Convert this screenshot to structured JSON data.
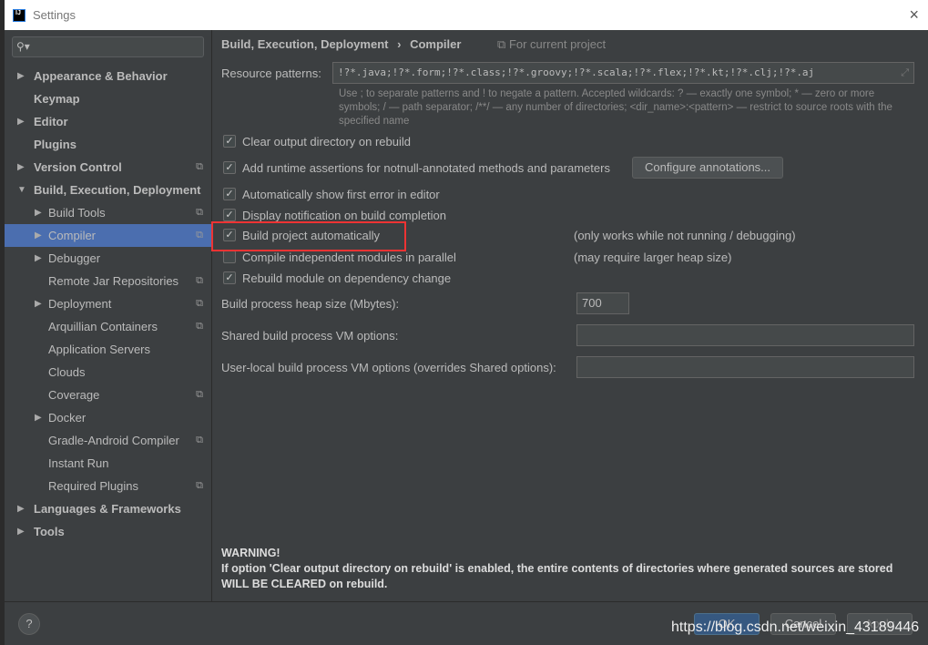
{
  "window": {
    "title": "Settings",
    "logo": "IJ",
    "close": "×"
  },
  "sidebar": {
    "search_placeholder": "",
    "items": [
      {
        "label": "Appearance & Behavior",
        "arrow": "▶",
        "bold": true
      },
      {
        "label": "Keymap",
        "bold": true
      },
      {
        "label": "Editor",
        "arrow": "▶",
        "bold": true
      },
      {
        "label": "Plugins",
        "bold": true
      },
      {
        "label": "Version Control",
        "arrow": "▶",
        "bold": true,
        "project": true
      },
      {
        "label": "Build, Execution, Deployment",
        "arrow": "▼",
        "bold": true
      },
      {
        "label": "Build Tools",
        "arrow": "▶",
        "child": true,
        "project": true
      },
      {
        "label": "Compiler",
        "arrow": "▶",
        "child": true,
        "project": true,
        "selected": true
      },
      {
        "label": "Debugger",
        "arrow": "▶",
        "child": true
      },
      {
        "label": "Remote Jar Repositories",
        "child": true,
        "project": true
      },
      {
        "label": "Deployment",
        "arrow": "▶",
        "child": true,
        "project": true
      },
      {
        "label": "Arquillian Containers",
        "child": true,
        "project": true
      },
      {
        "label": "Application Servers",
        "child": true
      },
      {
        "label": "Clouds",
        "child": true
      },
      {
        "label": "Coverage",
        "child": true,
        "project": true
      },
      {
        "label": "Docker",
        "arrow": "▶",
        "child": true
      },
      {
        "label": "Gradle-Android Compiler",
        "child": true,
        "project": true
      },
      {
        "label": "Instant Run",
        "child": true
      },
      {
        "label": "Required Plugins",
        "child": true,
        "project": true
      },
      {
        "label": "Languages & Frameworks",
        "arrow": "▶",
        "bold": true
      },
      {
        "label": "Tools",
        "arrow": "▶",
        "bold": true
      }
    ]
  },
  "breadcrumb": {
    "parent": "Build, Execution, Deployment",
    "sep": "›",
    "current": "Compiler",
    "scope": "For current project"
  },
  "resource": {
    "label": "Resource patterns:",
    "value": "!?*.java;!?*.form;!?*.class;!?*.groovy;!?*.scala;!?*.flex;!?*.kt;!?*.clj;!?*.aj"
  },
  "hint": "Use ; to separate patterns and ! to negate a pattern. Accepted wildcards: ? — exactly one symbol; * — zero or more symbols; / — path separator; /**/ — any number of directories; <dir_name>:<pattern> — restrict to source roots with the specified name",
  "checkboxes": [
    {
      "label": "Clear output directory on rebuild",
      "checked": true
    },
    {
      "label": "Add runtime assertions for notnull-annotated methods and parameters",
      "checked": true
    },
    {
      "label": "Automatically show first error in editor",
      "checked": true
    },
    {
      "label": "Display notification on build completion",
      "checked": true
    },
    {
      "label": "Build project automatically",
      "checked": true,
      "note": "(only works while not running / debugging)"
    },
    {
      "label": "Compile independent modules in parallel",
      "checked": false,
      "note": "(may require larger heap size)"
    },
    {
      "label": "Rebuild module on dependency change",
      "checked": true
    }
  ],
  "configure_button": "Configure annotations...",
  "heap": {
    "label": "Build process heap size (Mbytes):",
    "value": "700"
  },
  "shared_vm": {
    "label": "Shared build process VM options:",
    "value": ""
  },
  "user_vm": {
    "label": "User-local build process VM options (overrides Shared options):",
    "value": ""
  },
  "warning": {
    "title": "WARNING!",
    "text": "If option 'Clear output directory on rebuild' is enabled, the entire contents of directories where generated sources are stored WILL BE CLEARED on rebuild."
  },
  "footer": {
    "help": "?",
    "ok": "OK",
    "cancel": "Cancel",
    "apply": "Apply"
  },
  "watermark": "https://blog.csdn.net/weixin_43189446"
}
